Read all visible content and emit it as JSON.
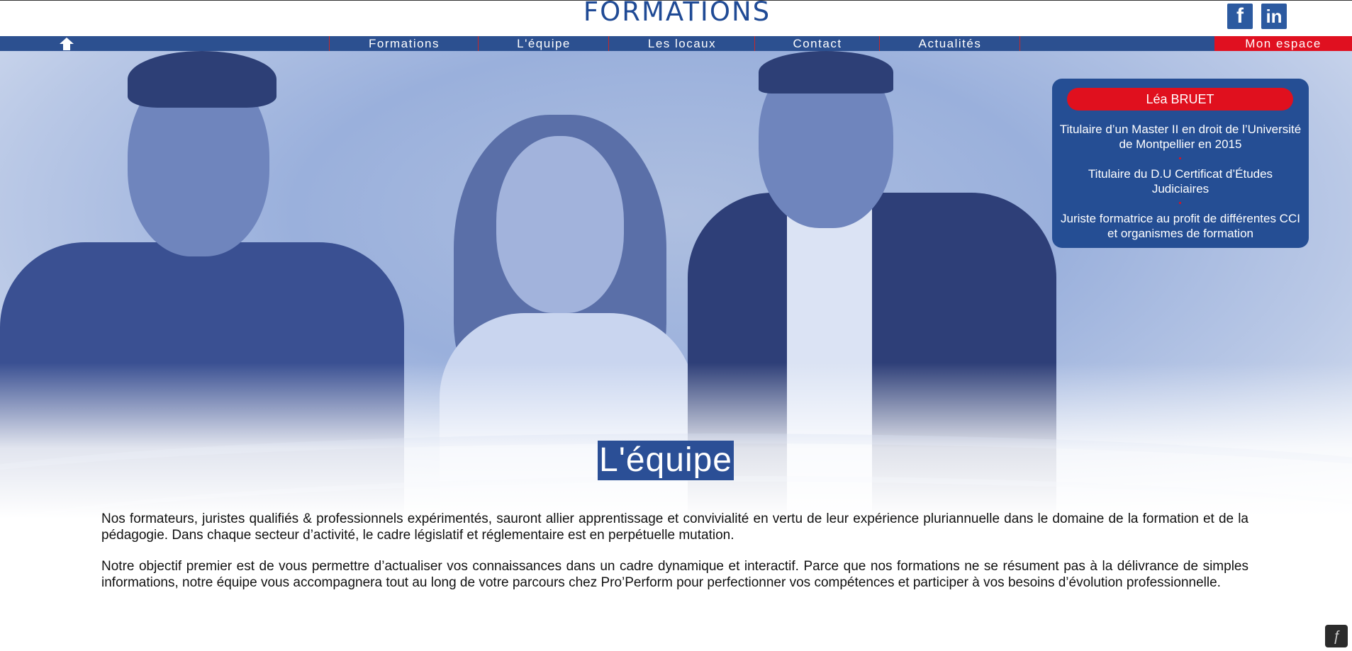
{
  "header": {
    "logo": "FORMATIONS",
    "social": {
      "facebook": "f",
      "linkedin": "in"
    }
  },
  "nav": {
    "items": [
      {
        "label": "Formations"
      },
      {
        "label": "L'équipe"
      },
      {
        "label": "Les locaux"
      },
      {
        "label": "Contact"
      },
      {
        "label": "Actualités"
      }
    ],
    "espace": "Mon espace"
  },
  "hero": {
    "title": "L'équipe"
  },
  "profile": {
    "name": "Léa BRUET",
    "lines": [
      "Titulaire d’un Master II en droit de l’Université de Montpellier en 2015",
      "Titulaire du D.U Certificat d’Études Judiciaires",
      "Juriste formatrice au profit de différentes CCI et organismes de formation"
    ]
  },
  "content": {
    "paragraphs": [
      "Nos formateurs, juristes qualifiés & professionnels expérimentés, sauront allier apprentissage et convivialité en vertu de leur expérience pluriannuelle dans le domaine de la formation et de la pédagogie. Dans chaque secteur d’activité, le cadre législatif et réglementaire est en perpétuelle mutation.",
      "Notre objectif premier est de vous permettre d’actualiser vos connaissances dans un cadre dynamique et interactif. Parce que nos formations ne se résument pas à la délivrance de simples informations, notre équipe vous accompagnera tout au long de votre parcours chez Pro’Perform pour perfectionner vos compétences et participer à vos besoins d’évolution professionnelle."
    ]
  },
  "colors": {
    "brand_blue": "#2c5090",
    "accent_red": "#e0101e"
  }
}
